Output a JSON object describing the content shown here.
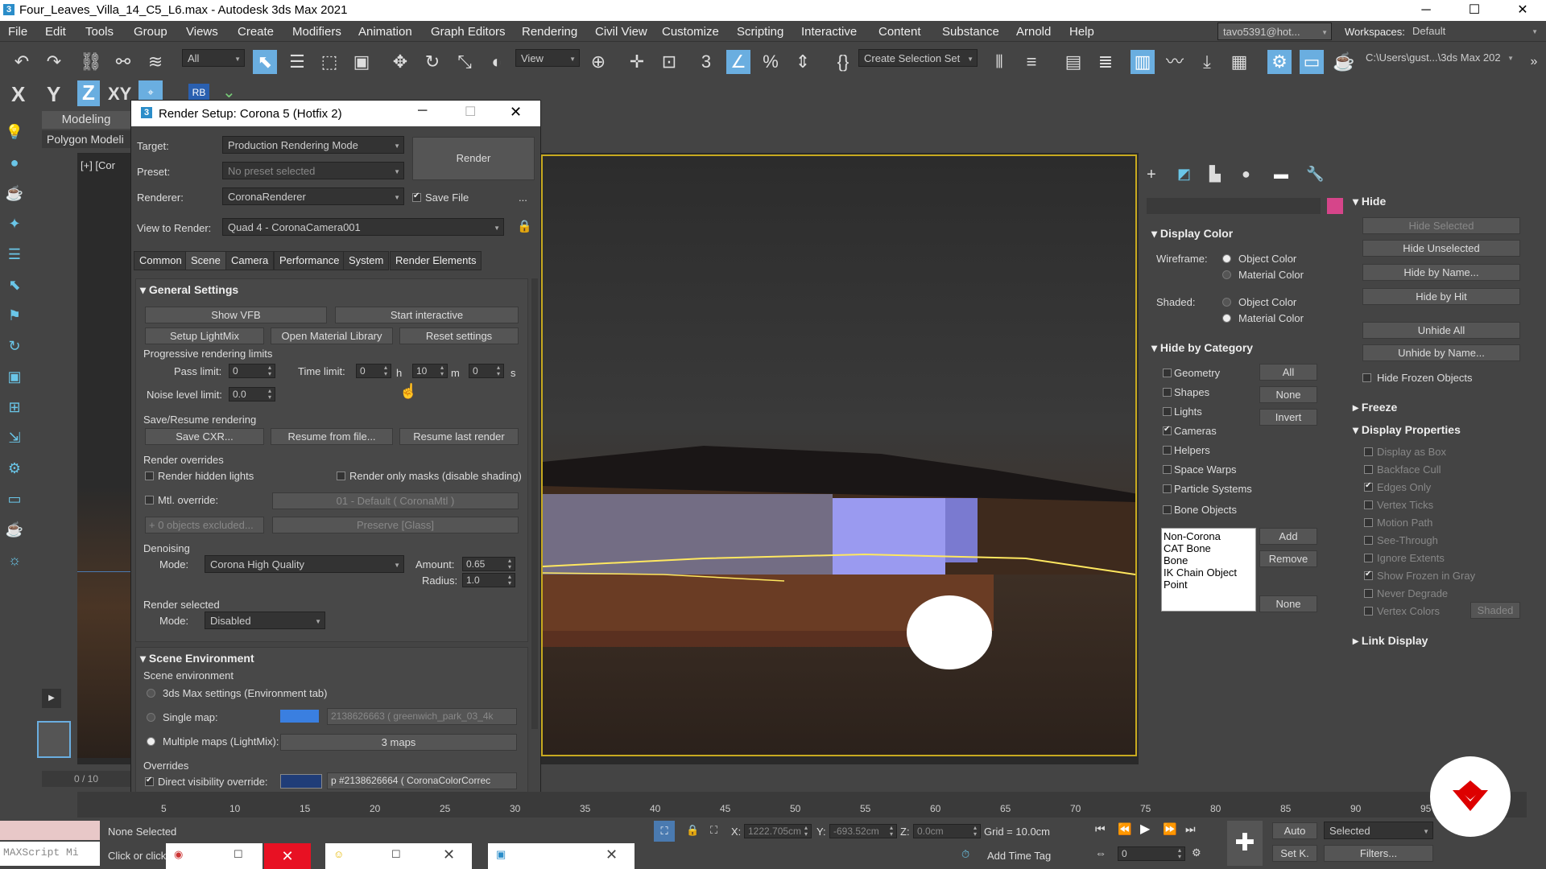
{
  "window": {
    "title": "Four_Leaves_Villa_14_C5_L6.max - Autodesk 3ds Max 2021",
    "min": "─",
    "max": "☐",
    "close": "✕"
  },
  "menu": [
    "File",
    "Edit",
    "Tools",
    "Group",
    "Views",
    "Create",
    "Modifiers",
    "Animation",
    "Graph Editors",
    "Rendering",
    "Civil View",
    "Customize",
    "Scripting",
    "Interactive",
    "Content",
    "Substance",
    "Arnold",
    "Help"
  ],
  "user": "tavo5391@hot...",
  "workspaces_label": "Workspaces:",
  "workspace": "Default",
  "toolbar": {
    "filter": "All",
    "refcoord": "View",
    "selset": "Create Selection Set",
    "path": "C:\\Users\\gust...\\3ds Max 202"
  },
  "axis": {
    "x": "X",
    "y": "Y",
    "z": "Z",
    "xy": "XY"
  },
  "ribbon": {
    "tab": "Modeling",
    "sub": "Polygon Modeli"
  },
  "viewport_label": "[+] [Cor",
  "dialog": {
    "title": "Render Setup: Corona 5 (Hotfix 2)",
    "target_label": "Target:",
    "target": "Production Rendering Mode",
    "preset_label": "Preset:",
    "preset": "No preset selected",
    "renderer_label": "Renderer:",
    "renderer": "CoronaRenderer",
    "save_file": "Save File",
    "dots": "...",
    "view_label": "View to Render:",
    "view": "Quad 4 - CoronaCamera001",
    "render_btn": "Render",
    "tabs": [
      "Common",
      "Scene",
      "Camera",
      "Performance",
      "System",
      "Render Elements"
    ],
    "general": "General Settings",
    "show_vfb": "Show VFB",
    "start_interactive": "Start interactive",
    "setup_lightmix": "Setup LightMix",
    "open_mat_lib": "Open Material Library",
    "reset_settings": "Reset settings",
    "prog_limits": "Progressive rendering limits",
    "pass_limit_label": "Pass limit:",
    "pass_limit": "0",
    "time_limit_label": "Time limit:",
    "time_h": "0",
    "h": "h",
    "time_m": "10",
    "m": "m",
    "time_s": "0",
    "s": "s",
    "noise_label": "Noise level limit:",
    "noise": "0.0",
    "save_resume": "Save/Resume rendering",
    "save_cxr": "Save CXR...",
    "resume_file": "Resume from file...",
    "resume_last": "Resume last render",
    "overrides": "Render overrides",
    "render_hidden": "Render hidden lights",
    "render_masks": "Render only masks (disable shading)",
    "mtl_override": "Mtl. override:",
    "mtl_value": "01 - Default  ( CoronaMtl )",
    "excluded": "+ 0 objects excluded...",
    "preserve": "Preserve [Glass]",
    "denoising": "Denoising",
    "mode_label": "Mode:",
    "den_mode": "Corona High Quality",
    "amount_label": "Amount:",
    "amount": "0.65",
    "radius_label": "Radius:",
    "radius": "1.0",
    "render_selected": "Render selected",
    "sel_mode": "Disabled",
    "scene_env": "Scene Environment",
    "scene_env_sub": "Scene environment",
    "env_max": "3ds Max settings (Environment tab)",
    "single_map": "Single map:",
    "single_map_val": "2138626663 ( greenwich_park_03_4k",
    "multi_maps": "Multiple maps (LightMix):",
    "multi_val": "3 maps",
    "overrides2": "Overrides",
    "direct_vis": "Direct visibility override:",
    "direct_val": "p #2138626664  ( CoronaColorCorrec"
  },
  "display": {
    "display_color": "Display Color",
    "wireframe": "Wireframe:",
    "shaded": "Shaded:",
    "object_color": "Object Color",
    "material_color": "Material Color",
    "hide_by_cat": "Hide by Category",
    "cats": [
      "Geometry",
      "Shapes",
      "Lights",
      "Cameras",
      "Helpers",
      "Space Warps",
      "Particle Systems",
      "Bone Objects"
    ],
    "all": "All",
    "none": "None",
    "invert": "Invert",
    "list": [
      "Non-Corona",
      "CAT Bone",
      "Bone",
      "IK Chain Object",
      "Point"
    ],
    "add": "Add",
    "remove": "Remove",
    "none2": "None"
  },
  "hide": {
    "title": "Hide",
    "hide_selected": "Hide Selected",
    "hide_unselected": "Hide Unselected",
    "hide_by_name": "Hide by Name...",
    "hide_by_hit": "Hide by Hit",
    "unhide_all": "Unhide All",
    "unhide_by_name": "Unhide by Name...",
    "hide_frozen": "Hide Frozen Objects",
    "freeze": "Freeze",
    "display_props": "Display Properties",
    "props": [
      "Display as Box",
      "Backface Cull",
      "Edges Only",
      "Vertex Ticks",
      "Motion Path",
      "See-Through",
      "Ignore Extents",
      "Show Frozen in Gray",
      "Never Degrade",
      "Vertex Colors"
    ],
    "shaded": "Shaded",
    "link_display": "Link Display"
  },
  "status": {
    "none_selected": "None Selected",
    "click": "Click or click",
    "maxscript": "MAXScript Mi",
    "x_label": "X:",
    "x": "1222.705cm",
    "y_label": "Y:",
    "y": "-693.52cm",
    "z_label": "Z:",
    "z": "0.0cm",
    "grid": "Grid = 10.0cm",
    "add_time_tag": "Add Time Tag",
    "frame": "0",
    "auto": "Auto",
    "selected": "Selected",
    "setk": "Set K.",
    "filters": "Filters...",
    "time_slider": "0 / 10"
  },
  "ticks": [
    "5",
    "10",
    "15",
    "20",
    "25",
    "30",
    "35",
    "40",
    "45",
    "50",
    "55",
    "60",
    "65",
    "70",
    "75",
    "80",
    "85",
    "90",
    "95"
  ],
  "colors": {
    "accent": "#c8aa20",
    "swatch": "#d6458a",
    "env": "#3a7fe0"
  }
}
